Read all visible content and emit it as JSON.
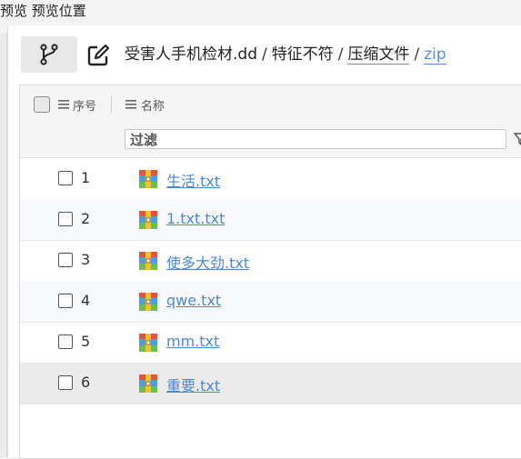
{
  "window": {
    "title": "预览 预览位置"
  },
  "path": {
    "crumbs": [
      "受害人手机检材.dd",
      "特征不符",
      "压缩文件"
    ],
    "current": "zip",
    "separator": "/"
  },
  "table": {
    "columns": {
      "index": "序号",
      "name": "名称"
    },
    "filter_placeholder": "过滤",
    "rows": [
      {
        "num": "1",
        "name": "生活.txt"
      },
      {
        "num": "2",
        "name": "1.txt.txt"
      },
      {
        "num": "3",
        "name": "使多大劲.txt"
      },
      {
        "num": "4",
        "name": "qwe.txt"
      },
      {
        "num": "5",
        "name": "mm.txt"
      },
      {
        "num": "6",
        "name": "重要.txt"
      }
    ]
  },
  "colors": {
    "link": "#4a88d6",
    "alt_row": "#f7f9fc",
    "selected_row": "#ebebeb"
  },
  "icons": {
    "branch": "git-branch-icon",
    "edit": "edit-icon",
    "file": "archive-file-icon",
    "menu": "menu-lines-icon",
    "filter": "filter-funnel-icon"
  }
}
